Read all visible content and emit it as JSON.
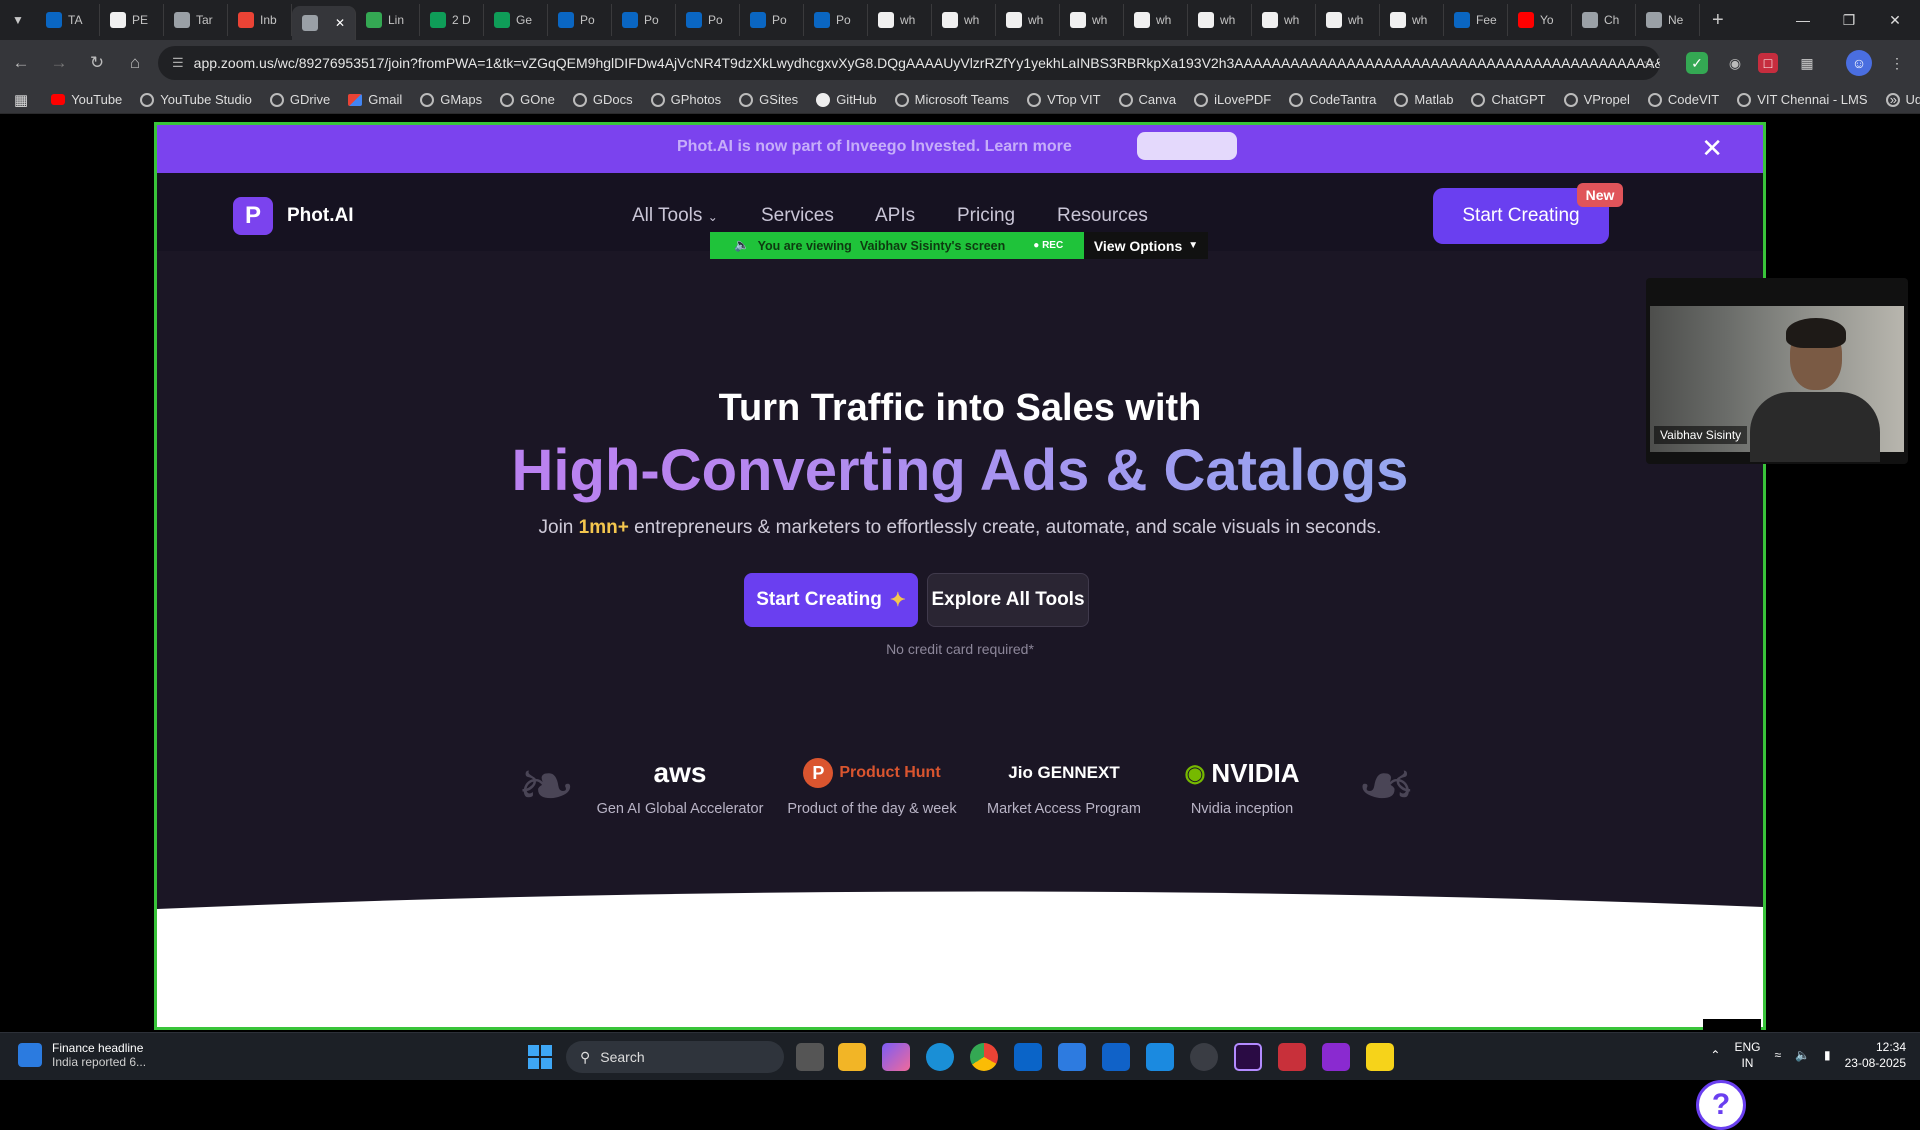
{
  "browser": {
    "tabs": [
      {
        "label": "TA",
        "icon": "linkedin-icon",
        "color": "#0a66c2"
      },
      {
        "label": "PE",
        "icon": "github-icon",
        "color": "#f0f0f0"
      },
      {
        "label": "Tar",
        "icon": "globe-icon",
        "color": "#9aa0a6"
      },
      {
        "label": "Inb",
        "icon": "gmail-icon",
        "color": "#ea4335"
      },
      {
        "label": "",
        "icon": "audio-icon",
        "color": "#9aa0a6",
        "active": true
      },
      {
        "label": "Lin",
        "icon": "dots-icon",
        "color": "#34a853"
      },
      {
        "label": "2 D",
        "icon": "sheets-icon",
        "color": "#0f9d58"
      },
      {
        "label": "Ge",
        "icon": "sheets-icon",
        "color": "#0f9d58"
      },
      {
        "label": "Po",
        "icon": "linkedin-icon",
        "color": "#0a66c2"
      },
      {
        "label": "Po",
        "icon": "linkedin-icon",
        "color": "#0a66c2"
      },
      {
        "label": "Po",
        "icon": "linkedin-icon",
        "color": "#0a66c2"
      },
      {
        "label": "Po",
        "icon": "linkedin-icon",
        "color": "#0a66c2"
      },
      {
        "label": "Po",
        "icon": "linkedin-icon",
        "color": "#0a66c2"
      },
      {
        "label": "wh",
        "icon": "google-icon",
        "color": "#f0f0f0"
      },
      {
        "label": "wh",
        "icon": "google-icon",
        "color": "#f0f0f0"
      },
      {
        "label": "wh",
        "icon": "google-icon",
        "color": "#f0f0f0"
      },
      {
        "label": "wh",
        "icon": "google-icon",
        "color": "#f0f0f0"
      },
      {
        "label": "wh",
        "icon": "google-icon",
        "color": "#f0f0f0"
      },
      {
        "label": "wh",
        "icon": "google-icon",
        "color": "#f0f0f0"
      },
      {
        "label": "wh",
        "icon": "google-icon",
        "color": "#f0f0f0"
      },
      {
        "label": "wh",
        "icon": "google-icon",
        "color": "#f0f0f0"
      },
      {
        "label": "wh",
        "icon": "google-icon",
        "color": "#f0f0f0"
      },
      {
        "label": "Fee",
        "icon": "linkedin-icon",
        "color": "#0a66c2"
      },
      {
        "label": "Yo",
        "icon": "youtube-icon",
        "color": "#ff0000"
      },
      {
        "label": "Ch",
        "icon": "chatgpt-icon",
        "color": "#9aa0a6"
      },
      {
        "label": "Ne",
        "icon": "chatgpt-icon",
        "color": "#9aa0a6"
      }
    ],
    "url": "app.zoom.us/wc/89276953517/join?fromPWA=1&tk=vZGqQEM9hglDIFDw4AjVcNR4T9dzXkLwydhcgxvXyG8.DQgAAAAUyVlzrRZfYy1yekhLaINBS3RBRkpXa193V2h3AAAAAAAAAAAAAAAAAAAAAAAAAAAAAAAAAAAAAAAAAAAAA&_x_zm_r...",
    "bookmarks": [
      {
        "label": "YouTube",
        "icon": "yt"
      },
      {
        "label": "YouTube Studio",
        "icon": ""
      },
      {
        "label": "GDrive",
        "icon": ""
      },
      {
        "label": "Gmail",
        "icon": "gm"
      },
      {
        "label": "GMaps",
        "icon": ""
      },
      {
        "label": "GOne",
        "icon": ""
      },
      {
        "label": "GDocs",
        "icon": ""
      },
      {
        "label": "GPhotos",
        "icon": ""
      },
      {
        "label": "GSites",
        "icon": ""
      },
      {
        "label": "GitHub",
        "icon": "gh"
      },
      {
        "label": "Microsoft Teams",
        "icon": ""
      },
      {
        "label": "VTop VIT",
        "icon": ""
      },
      {
        "label": "Canva",
        "icon": ""
      },
      {
        "label": "iLovePDF",
        "icon": ""
      },
      {
        "label": "CodeTantra",
        "icon": ""
      },
      {
        "label": "Matlab",
        "icon": ""
      },
      {
        "label": "ChatGPT",
        "icon": ""
      },
      {
        "label": "VPropel",
        "icon": ""
      },
      {
        "label": "CodeVIT",
        "icon": ""
      },
      {
        "label": "VIT Chennai - LMS",
        "icon": ""
      },
      {
        "label": "Udemy",
        "icon": ""
      }
    ]
  },
  "zoom": {
    "viewing_prefix": "You are viewing",
    "viewing_name": "Vaibhav Sisinty's screen",
    "rec_label": "REC",
    "view_options": "View Options",
    "participant_name": "Vaibhav Sisinty"
  },
  "site": {
    "promo_text": "Phot.AI is now part of Inveego Invested. Learn more",
    "logo_letter": "P",
    "logo_name": "Phot.AI",
    "nav": {
      "all_tools": "All Tools",
      "services": "Services",
      "apis": "APIs",
      "pricing": "Pricing",
      "resources": "Resources"
    },
    "start_creating_top": "Start Creating",
    "new_badge": "New",
    "hero": {
      "line1": "Turn Traffic into Sales with",
      "line2": "High-Converting Ads & Catalogs",
      "sub_before": "Join ",
      "sub_highlight": "1mn+",
      "sub_after": " entrepreneurs & marketers to effortlessly create, automate, and scale visuals in seconds.",
      "cta_start": "Start Creating",
      "cta_explore": "Explore All Tools",
      "no_cc": "No credit card required*"
    },
    "partners": [
      {
        "brand": "aws",
        "caption": "Gen AI Global Accelerator"
      },
      {
        "brand": "Product Hunt",
        "caption": "Product of the day & week"
      },
      {
        "brand": "Jio GENNEXT",
        "caption": "Market Access Program"
      },
      {
        "brand": "NVIDIA",
        "caption": "Nvidia inception"
      }
    ]
  },
  "taskbar": {
    "news_title": "Finance headline",
    "news_sub": "India reported 6...",
    "search_placeholder": "Search",
    "lang_top": "ENG",
    "lang_bottom": "IN",
    "time": "12:34",
    "date": "23-08-2025"
  }
}
